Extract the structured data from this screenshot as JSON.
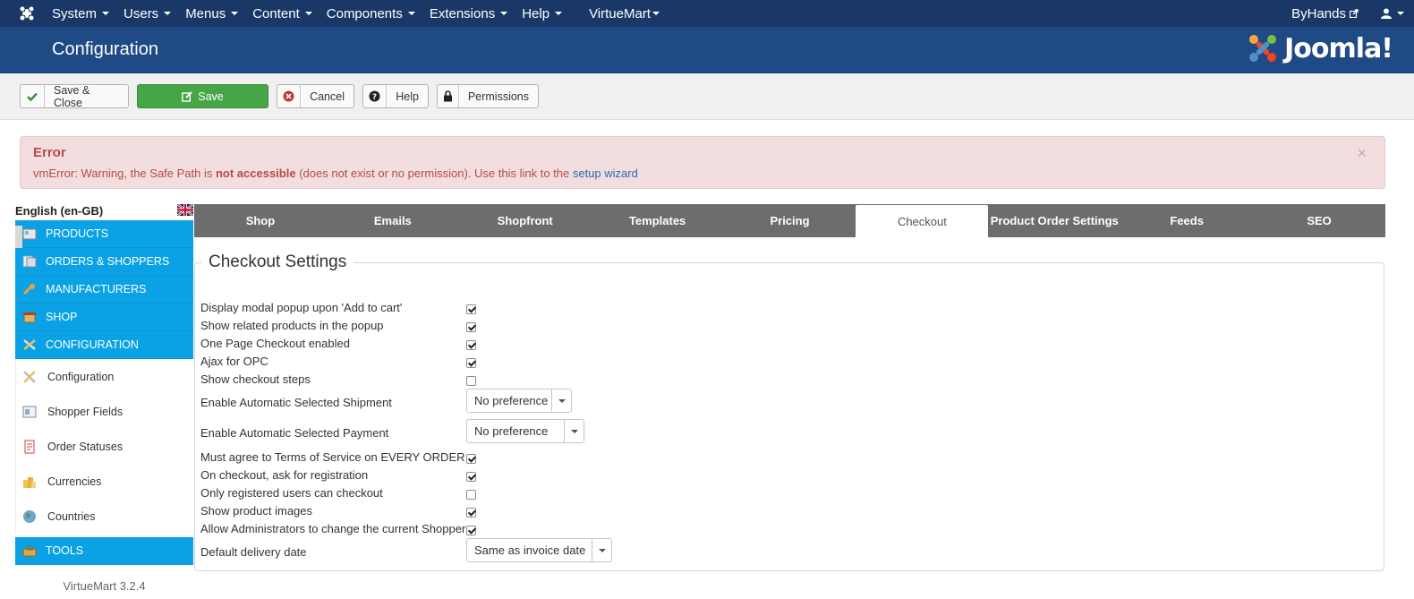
{
  "topnav": {
    "menus": [
      "System",
      "Users",
      "Menus",
      "Content",
      "Components",
      "Extensions",
      "Help",
      "VirtueMart"
    ],
    "site_link": "ByHands"
  },
  "header": {
    "title": "Configuration",
    "brand": "Joomla!"
  },
  "toolbar": {
    "save_close": "Save & Close",
    "save": "Save",
    "cancel": "Cancel",
    "help": "Help",
    "permissions": "Permissions"
  },
  "alert": {
    "heading": "Error",
    "msg_prefix": "vmError: Warning, the Safe Path is ",
    "msg_bold": "not accessible",
    "msg_middle": " (does not exist or no permission). Use this link to the ",
    "msg_link": "setup wizard"
  },
  "sidebar": {
    "language": "English (en-GB)",
    "sections": [
      "PRODUCTS",
      "ORDERS & SHOPPERS",
      "MANUFACTURERS",
      "SHOP",
      "CONFIGURATION"
    ],
    "sub_items": [
      "Configuration",
      "Shopper Fields",
      "Order Statuses",
      "Currencies",
      "Countries"
    ],
    "tools": "TOOLS",
    "version": "VirtueMart 3.2.4"
  },
  "tabs": [
    "Shop",
    "Emails",
    "Shopfront",
    "Templates",
    "Pricing",
    "Checkout",
    "Product Order Settings",
    "Feeds",
    "SEO"
  ],
  "active_tab": "Checkout",
  "checkout": {
    "legend": "Checkout Settings",
    "rows": [
      {
        "label": "Display modal popup upon 'Add to cart'",
        "checked": true
      },
      {
        "label": "Show related products in the popup",
        "checked": true
      },
      {
        "label": "One Page Checkout enabled",
        "checked": true
      },
      {
        "label": "Ajax for OPC",
        "checked": true
      },
      {
        "label": "Show checkout steps",
        "checked": false
      },
      {
        "label": "Enable Automatic Selected Shipment",
        "value": "No preference"
      },
      {
        "label": "Enable Automatic Selected Payment",
        "value": "No preference"
      },
      {
        "label": "Must agree to Terms of Service on EVERY ORDER",
        "checked": true
      },
      {
        "label": "On checkout, ask for registration",
        "checked": true
      },
      {
        "label": "Only registered users can checkout",
        "checked": false
      },
      {
        "label": "Show product images",
        "checked": true
      },
      {
        "label": "Allow Administrators to change the current Shopper",
        "checked": true
      },
      {
        "label": "Default delivery date",
        "value": "Same as invoice date"
      }
    ]
  }
}
